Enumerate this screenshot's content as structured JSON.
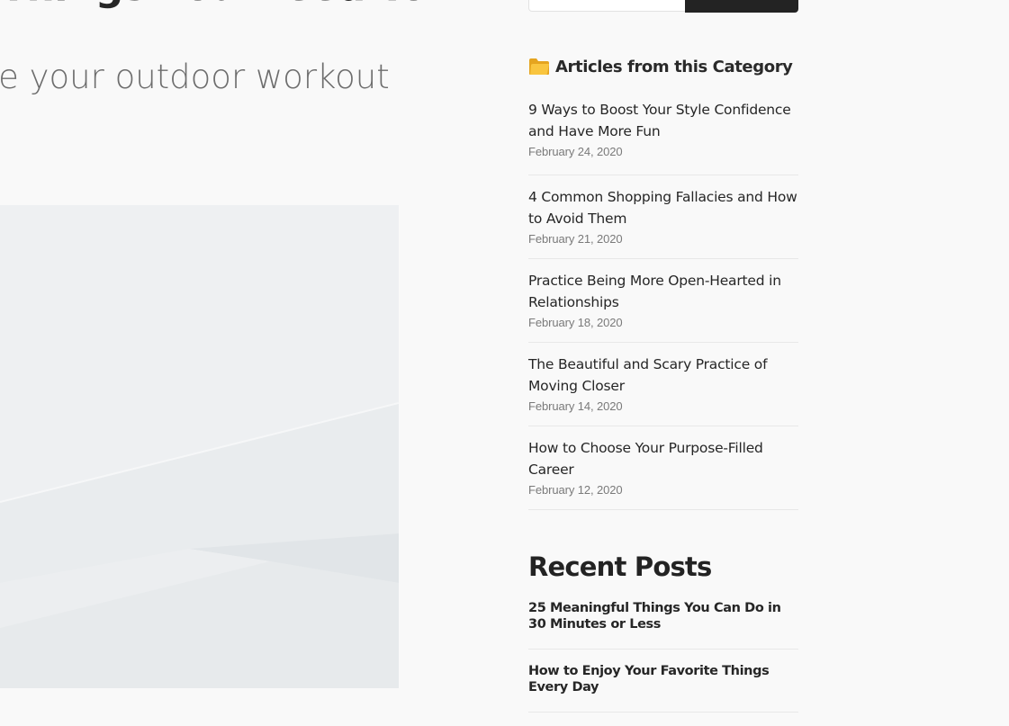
{
  "post": {
    "title": "Things You Need To",
    "subtitle": "ke your outdoor workout"
  },
  "search": {
    "placeholder": ""
  },
  "category_widget": {
    "title": "Articles from this Category",
    "icon": "folder-icon",
    "articles": [
      {
        "title": "9 Ways to Boost Your Style Confidence and Have More Fun",
        "date": "February 24, 2020"
      },
      {
        "title": "4 Common Shopping Fallacies and How to Avoid Them",
        "date": "February 21, 2020"
      },
      {
        "title": "Practice Being More Open-Hearted in Relationships",
        "date": "February 18, 2020"
      },
      {
        "title": "The Beautiful and Scary Practice of Moving Closer",
        "date": "February 14, 2020"
      },
      {
        "title": "How to Choose Your Purpose-Filled Career",
        "date": "February 12, 2020"
      }
    ]
  },
  "recent_posts": {
    "title": "Recent Posts",
    "posts": [
      {
        "title": "25 Meaningful Things You Can Do in 30 Minutes or Less"
      },
      {
        "title": "How to Enjoy Your Favorite Things Every Day"
      }
    ]
  },
  "colors": {
    "background": "#f9f9f9",
    "button_dark": "#232323",
    "folder_icon": "#f5b82e"
  }
}
